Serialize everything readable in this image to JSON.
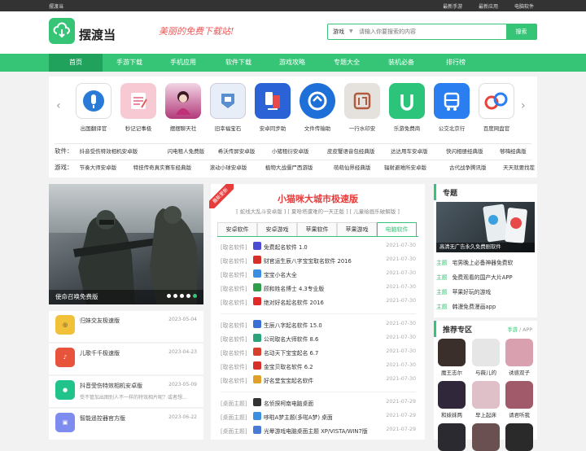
{
  "topbar": {
    "site": "摆渡当",
    "links": [
      "最新手游",
      "最新应用",
      "电脑软件"
    ]
  },
  "header": {
    "logo_text": "摆渡当",
    "slogan": "美丽的免费下载站!",
    "search_select": "游戏",
    "search_placeholder": "请输入你要搜索的内容",
    "search_button": "搜索"
  },
  "nav": [
    "首页",
    "手游下载",
    "手机应用",
    "软件下载",
    "游戏攻略",
    "专题大全",
    "装机必备",
    "排行榜"
  ],
  "apps": [
    {
      "name": "出国翻译官",
      "color": "#2a7bd8"
    },
    {
      "name": "秒记记事极",
      "color": "#e88aa0"
    },
    {
      "name": "摆摆聊天社",
      "color": "#b23a7a"
    },
    {
      "name": "旧幸福宝石",
      "color": "#5a8fcf"
    },
    {
      "name": "安卓同步助",
      "color": "#2b62d6"
    },
    {
      "name": "文件传输助",
      "color": "#1e6fd8"
    },
    {
      "name": "一行水印安",
      "color": "#d9d5cf"
    },
    {
      "name": "乐游免费商",
      "color": "#2cc37a"
    },
    {
      "name": "公交北京行",
      "color": "#2a7ef0"
    },
    {
      "name": "百度网盘官",
      "color": "#ffffff"
    }
  ],
  "categories": {
    "software_key": "软件：",
    "software": [
      "抖音受伤特效相机安卓版",
      "闪电租人免费版",
      "希沃传屏安卓版",
      "小猪租衍安卓版",
      "皮皮蟹语音包经典版",
      "达达用车安卓版",
      "快闪相册经典版",
      "够嗨经典版",
      "贝果"
    ],
    "game_key": "游戏：",
    "games": [
      "节奏大师安卓版",
      "特技传奇真实赛车经典版",
      "滚动小球安卓版",
      "植物大战僵尸西游版",
      "萌萌仙界经典版",
      "辐射避难所安卓版",
      "古代战争腾讯版",
      "天天就要找茬安卓"
    ]
  },
  "banner": {
    "caption": "使命召唤免费版"
  },
  "side_items": [
    {
      "name": "归妹交友极速版",
      "date": "2023-05-04",
      "desc": "",
      "color": "#f2c13a"
    },
    {
      "name": "儿歌千千极速版",
      "date": "2023-04-23",
      "desc": "",
      "color": "#e8533b"
    },
    {
      "name": "抖音受伤特效相机安卓版",
      "date": "2023-05-09",
      "desc": "受不管加出图别人不一样的特效相片呢？或者想...",
      "color": "#20c48b"
    },
    {
      "name": "智能遥控器官方版",
      "date": "2023-06-22",
      "desc": "",
      "color": "#7e8cf0"
    }
  ],
  "mid": {
    "ribbon": "最新更新",
    "headline": "小猫咪大城市极速版",
    "subline": "[ 蛇线大乱斗安卓版 ] [ 夏哈塔遭难的一天正版 ] [ 儿童绘画乐破解版 ]",
    "tabs": [
      "安卓软件",
      "安卓游戏",
      "苹果软件",
      "苹果游戏",
      "电脑软件"
    ],
    "groups": [
      [
        {
          "cat": "[取名软件]",
          "name": "免费起名软件 1.0",
          "date": "2021-07-30",
          "color": "#4b4bd6"
        },
        {
          "cat": "[取名软件]",
          "name": "财官运生辰八字宝宝取名软件 2016",
          "date": "2021-07-30",
          "color": "#d6302a"
        },
        {
          "cat": "[取名软件]",
          "name": "宝宝小名大全",
          "date": "2021-07-30",
          "color": "#3b8fe0"
        },
        {
          "cat": "[取名软件]",
          "name": "顾和姓名博士 4.3专业版",
          "date": "2021-07-30",
          "color": "#2f9e4a"
        },
        {
          "cat": "[取名软件]",
          "name": "绝对好名起名软件 2016",
          "date": "2021-07-30",
          "color": "#e02a2a"
        }
      ],
      [
        {
          "cat": "[取名软件]",
          "name": "生辰八字起名软件 15.0",
          "date": "2021-07-30",
          "color": "#3a6fd6"
        },
        {
          "cat": "[取名软件]",
          "name": "公司取名大师软件 8.6",
          "date": "2021-07-30",
          "color": "#2ba37a"
        },
        {
          "cat": "[取名软件]",
          "name": "名动天下宝宝起名 6.7",
          "date": "2021-07-30",
          "color": "#d6402a"
        },
        {
          "cat": "[取名软件]",
          "name": "金宝贝取名软件 6.2",
          "date": "2021-07-30",
          "color": "#d6302a"
        },
        {
          "cat": "[取名软件]",
          "name": "好名堂宝宝起名软件",
          "date": "2021-07-30",
          "color": "#e0a02a"
        }
      ],
      [
        {
          "cat": "[桌面主题]",
          "name": "名侦探柯南电脑桌面",
          "date": "2021-07-29",
          "color": "#333333"
        },
        {
          "cat": "[桌面主题]",
          "name": "哆啦A梦主题(多啦A梦) 桌面",
          "date": "2021-07-29",
          "color": "#3a8fe0"
        },
        {
          "cat": "[桌面主题]",
          "name": "光晕游戏电脑桌面主题 XP/VISTA/WIN7版",
          "date": "2021-07-29",
          "color": "#4a7ad6"
        }
      ]
    ]
  },
  "topics": {
    "title": "专题",
    "image_caption": "高清无广告永久免费剧软件",
    "tag": "主题",
    "items": [
      "宅男晚上必备神器免费软",
      "免费观看的国产大片APP",
      "苹果好玩的游戏",
      "韩漫免费漫画app"
    ]
  },
  "recommend": {
    "title": "推荐专区",
    "more_a": "手游",
    "more_sep": "/",
    "more_b": "APP",
    "items": [
      {
        "name": "魔王志尔",
        "color": "#3a2f2a"
      },
      {
        "name": "与薇儿的",
        "color": "#e6e6e6"
      },
      {
        "name": "诱惑双子",
        "color": "#d9a0b0"
      },
      {
        "name": "和妹妹两",
        "color": "#30283a"
      },
      {
        "name": "早上起床",
        "color": "#e0c0c8"
      },
      {
        "name": "请君听我",
        "color": "#a05a6a"
      },
      {
        "name": "",
        "color": "#2a2a30"
      },
      {
        "name": "",
        "color": "#6a5050"
      },
      {
        "name": "",
        "color": "#2a2a2a"
      }
    ]
  }
}
